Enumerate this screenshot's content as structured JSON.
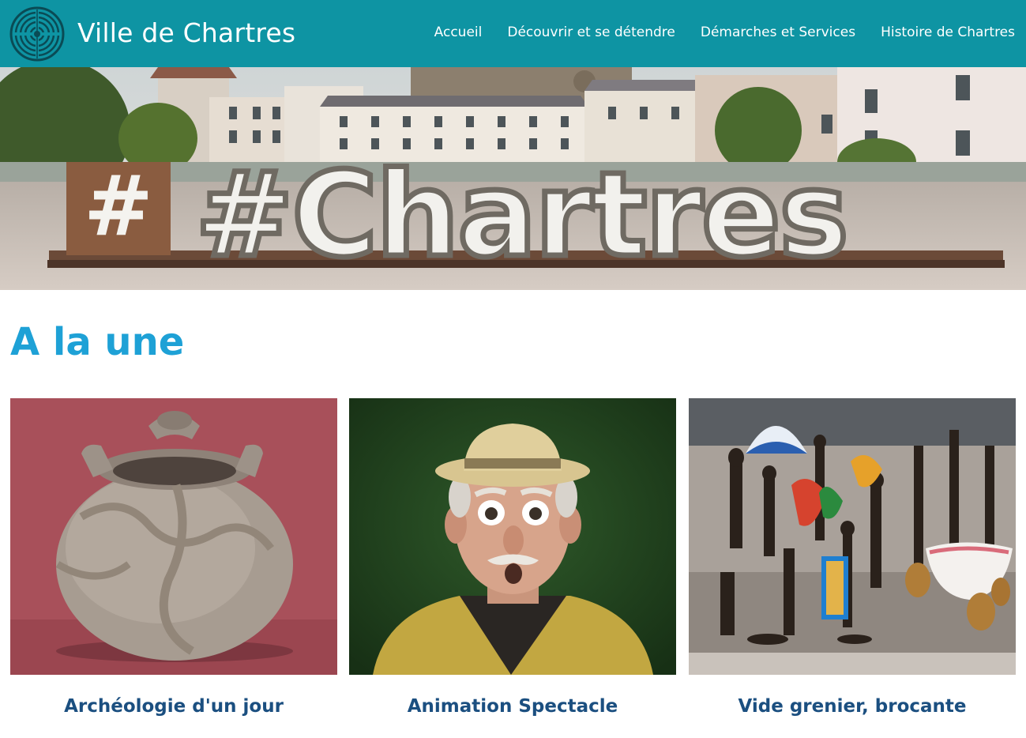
{
  "header": {
    "title": "Ville de Chartres",
    "logo_icon": "labyrinth-icon",
    "background": "#0e94a3"
  },
  "nav": {
    "items": [
      {
        "label": "Accueil"
      },
      {
        "label": "Découvrir et se détendre"
      },
      {
        "label": "Démarches et Services"
      },
      {
        "label": "Histoire de Chartres"
      }
    ]
  },
  "hero": {
    "sign_text": "#Chartres"
  },
  "section": {
    "title": "A la une",
    "title_color": "#1ea1d6"
  },
  "cards": [
    {
      "title": "Archéologie d'un jour"
    },
    {
      "title": "Animation Spectacle"
    },
    {
      "title": "Vide grenier, brocante"
    }
  ],
  "card_title_color": "#1b4f80"
}
